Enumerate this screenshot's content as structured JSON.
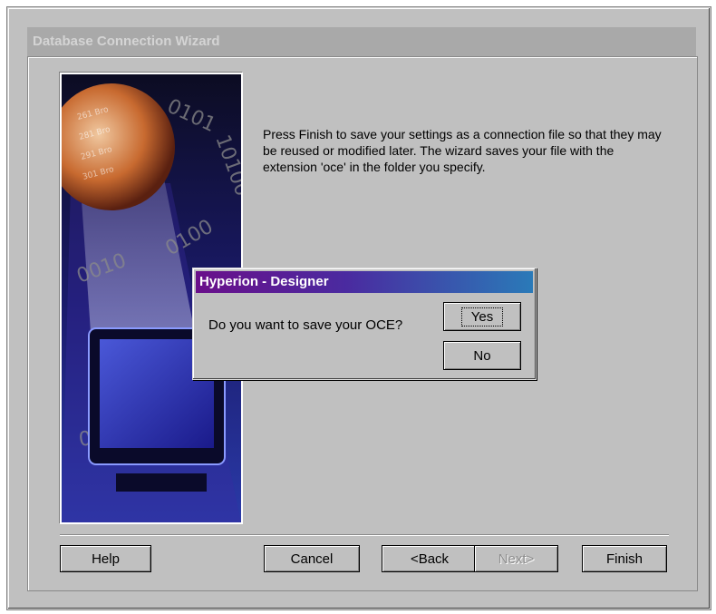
{
  "wizard": {
    "title": "Database Connection Wizard",
    "instruction": "Press Finish to save your settings as a connection file so that they may be reused or modified later. The wizard saves your file with the extension 'oce' in the folder you specify.",
    "image_icon": "database-graphic",
    "buttons": {
      "help": "Help",
      "cancel": "Cancel",
      "back": "<Back",
      "next": "Next>",
      "finish": "Finish"
    }
  },
  "dialog": {
    "title": "Hyperion - Designer",
    "message": "Do you want to save your OCE?",
    "yes": "Yes",
    "no": "No"
  },
  "colors": {
    "window_face": "#c0c0c0",
    "dialog_title_start": "#6a0f8a",
    "dialog_title_end": "#2a7ab8"
  }
}
